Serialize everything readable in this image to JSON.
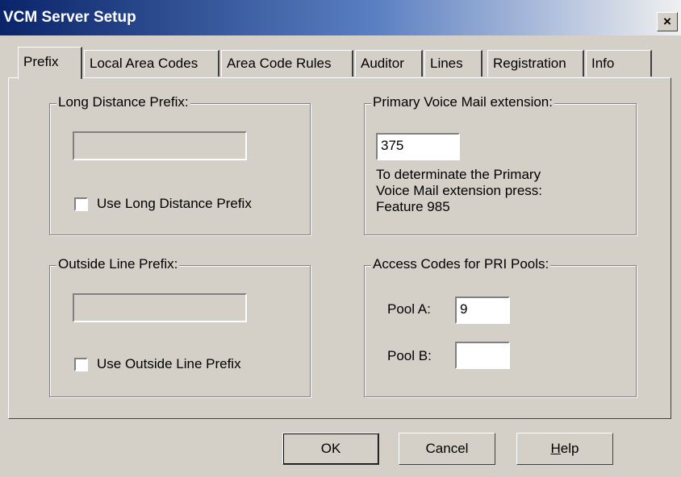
{
  "window": {
    "title": "VCM Server Setup",
    "close": "×"
  },
  "tabs": [
    "Prefix",
    "Local Area Codes",
    "Area Code Rules",
    "Auditor",
    "Lines",
    "Registration",
    "Info"
  ],
  "long_distance": {
    "legend": "Long Distance Prefix:",
    "value": "",
    "checkbox_label": "Use Long Distance Prefix",
    "checked": false
  },
  "outside_line": {
    "legend": "Outside Line Prefix:",
    "value": "",
    "checkbox_label": "Use Outside Line Prefix",
    "checked": false
  },
  "voice_mail": {
    "legend": "Primary Voice Mail extension:",
    "value": "375",
    "hint_line1": "To determinate the Primary",
    "hint_line2": "Voice Mail extension press:",
    "hint_line3": "Feature 985"
  },
  "pri_pools": {
    "legend": "Access Codes for PRI Pools:",
    "pool_a_label": "Pool A:",
    "pool_a_value": "9",
    "pool_b_label": "Pool B:",
    "pool_b_value": ""
  },
  "buttons": {
    "ok": "OK",
    "cancel": "Cancel",
    "help_first": "H",
    "help_rest": "elp"
  }
}
